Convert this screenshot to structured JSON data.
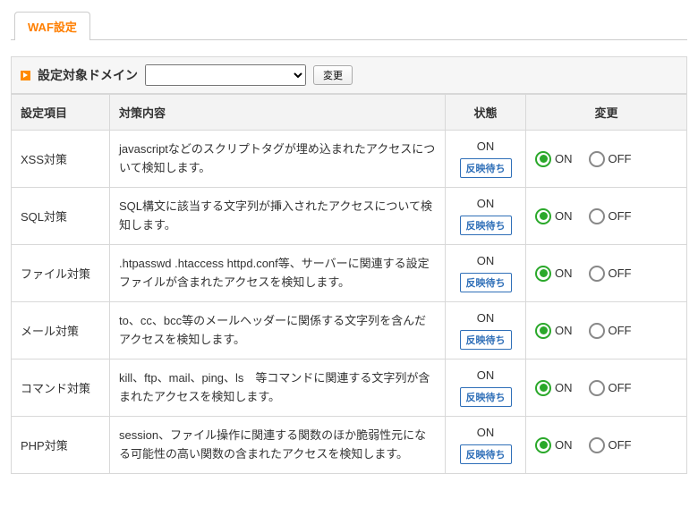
{
  "tab": {
    "label": "WAF設定"
  },
  "domain": {
    "label": "設定対象ドメイン",
    "selected": "",
    "change_label": "変更"
  },
  "headers": {
    "item": "設定項目",
    "description": "対策内容",
    "status": "状態",
    "change": "変更"
  },
  "status_badge": "反映待ち",
  "radio_on_label": "ON",
  "radio_off_label": "OFF",
  "rows": [
    {
      "item": "XSS対策",
      "description": "javascriptなどのスクリプトタグが埋め込まれたアクセスについて検知します。",
      "status": "ON",
      "selected": "ON"
    },
    {
      "item": "SQL対策",
      "description": "SQL構文に該当する文字列が挿入されたアクセスについて検知します。",
      "status": "ON",
      "selected": "ON"
    },
    {
      "item": "ファイル対策",
      "description": ".htpasswd .htaccess httpd.conf等、サーバーに関連する設定ファイルが含まれたアクセスを検知します。",
      "status": "ON",
      "selected": "ON"
    },
    {
      "item": "メール対策",
      "description": "to、cc、bcc等のメールヘッダーに関係する文字列を含んだアクセスを検知します。",
      "status": "ON",
      "selected": "ON"
    },
    {
      "item": "コマンド対策",
      "description": "kill、ftp、mail、ping、ls　等コマンドに関連する文字列が含まれたアクセスを検知します。",
      "status": "ON",
      "selected": "ON"
    },
    {
      "item": "PHP対策",
      "description": "session、ファイル操作に関連する関数のほか脆弱性元になる可能性の高い関数の含まれたアクセスを検知します。",
      "status": "ON",
      "selected": "ON"
    }
  ]
}
